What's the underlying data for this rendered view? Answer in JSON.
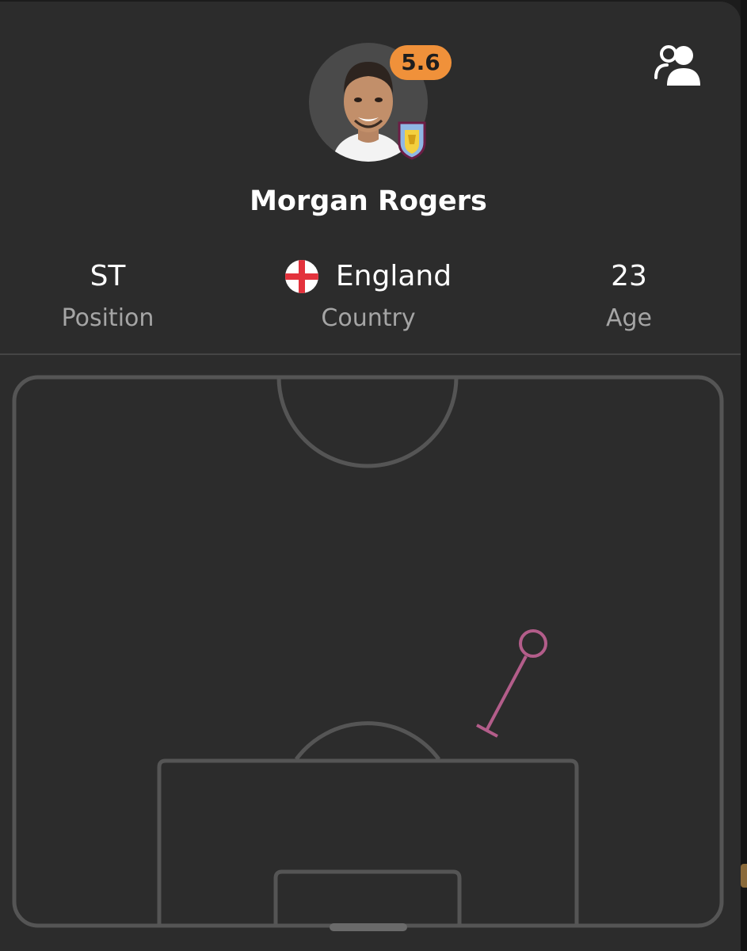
{
  "player": {
    "name": "Morgan Rogers",
    "rating": "5.6",
    "rating_color": "#f0913a"
  },
  "club_badge_icon": "aston-villa-crest-icon",
  "compare_icon": "compare-players-icon",
  "stats": {
    "position": {
      "value": "ST",
      "label": "Position"
    },
    "country": {
      "value": "England",
      "label": "Country",
      "flag_icon": "england-flag-icon"
    },
    "age": {
      "value": "23",
      "label": "Age"
    }
  },
  "shot_map": {
    "type": "scatter",
    "line_color": "#555555",
    "shot_color": "#b35d8a"
  }
}
